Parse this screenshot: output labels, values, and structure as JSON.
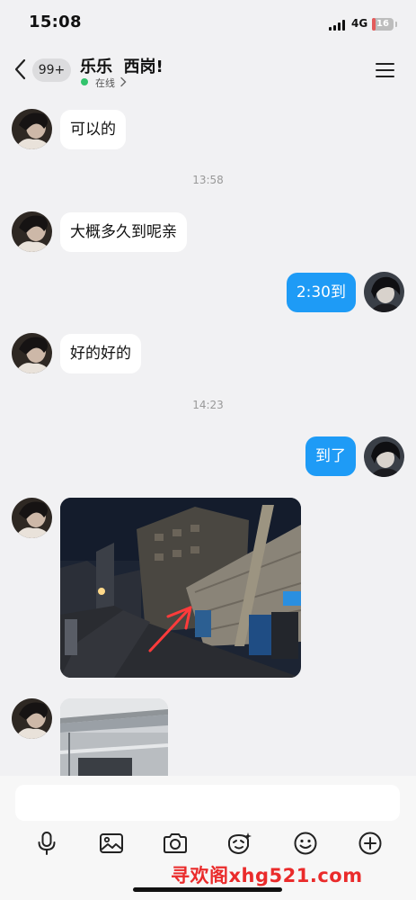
{
  "status_bar": {
    "time": "15:08",
    "network": "4G",
    "battery_level": "16",
    "battery_fraction": 0.16
  },
  "header": {
    "back_icon": "chevron-left-icon",
    "unread_badge": "99+",
    "title": "乐乐  西岗!",
    "presence": "在线",
    "menu_icon": "hamburger-menu-icon"
  },
  "messages": [
    {
      "direction": "incoming",
      "type": "text",
      "text": "可以的"
    },
    {
      "type": "timestamp",
      "text": "13:58"
    },
    {
      "direction": "incoming",
      "type": "text",
      "text": "大概多久到呢亲"
    },
    {
      "direction": "outgoing",
      "type": "text",
      "text": "2:30到"
    },
    {
      "direction": "incoming",
      "type": "text",
      "text": "好的好的"
    },
    {
      "type": "timestamp",
      "text": "14:23"
    },
    {
      "direction": "outgoing",
      "type": "text",
      "text": "到了"
    },
    {
      "direction": "incoming",
      "type": "image",
      "content": "night street photo with a red arrow"
    },
    {
      "direction": "incoming",
      "type": "image",
      "content": "building photo, partially visible"
    }
  ],
  "input": {
    "placeholder": ""
  },
  "toolbar": [
    "microphone-icon",
    "image-icon",
    "camera-icon",
    "sticker-icon",
    "emoji-icon",
    "plus-icon"
  ],
  "watermark": "寻欢阁xhg521.com",
  "colors": {
    "outgoing_bubble": "#1e9bf6",
    "incoming_bubble": "#ffffff",
    "background": "#f1f1f3",
    "online_dot": "#32c36c",
    "watermark": "#ea2b2b"
  }
}
